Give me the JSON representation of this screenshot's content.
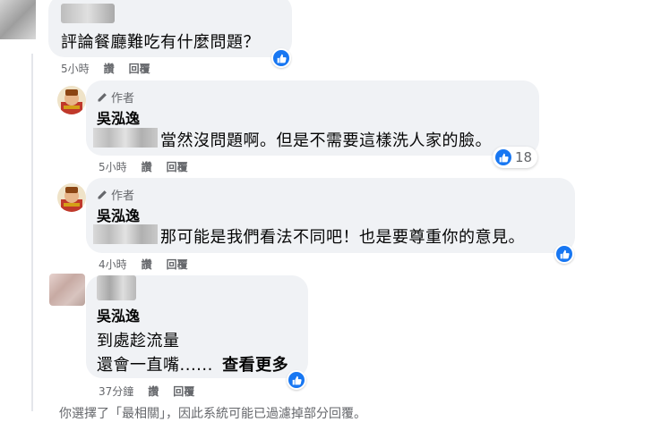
{
  "comments": [
    {
      "text": "評論餐廳難吃有什麼問題？",
      "time": "5小時",
      "like_label": "讚",
      "reply_label": "回覆"
    },
    {
      "author_badge": "作者",
      "name": "吳泓逸",
      "text": "當然沒問題啊。但是不需要這樣洗人家的臉。",
      "reaction_count": "18",
      "time": "5小時",
      "like_label": "讚",
      "reply_label": "回覆"
    },
    {
      "author_badge": "作者",
      "name": "吳泓逸",
      "text": "那可能是我們看法不同吧！也是要尊重你的意見。",
      "time": "4小時",
      "like_label": "讚",
      "reply_label": "回覆"
    },
    {
      "name": "吳泓逸",
      "text_line1": "到處趁流量",
      "text_line2": "還會一直嘴......",
      "see_more": "查看更多",
      "time": "37分鐘",
      "like_label": "讚",
      "reply_label": "回覆"
    }
  ],
  "footer_note": "你選擇了「最相關」，因此系統可能已過濾掉部分回覆。",
  "colors": {
    "bubble": "#f0f2f5",
    "like_blue": "#1877f2",
    "meta_gray": "#65676b"
  },
  "icons": [
    "thumbs-up-icon",
    "pencil-icon"
  ]
}
